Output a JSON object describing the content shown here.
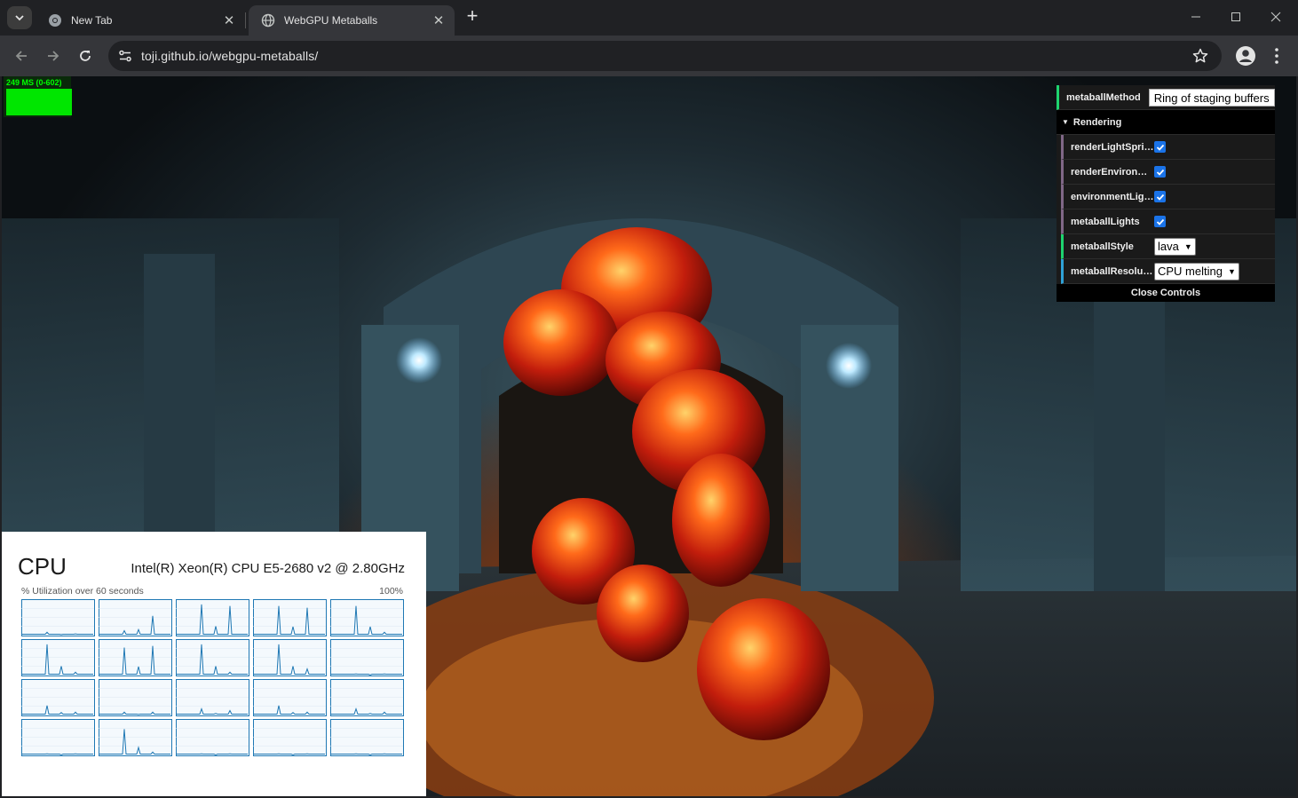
{
  "browser": {
    "tabs": [
      {
        "title": "New Tab",
        "active": false,
        "icon": "chrome-icon"
      },
      {
        "title": "WebGPU Metaballs",
        "active": true,
        "icon": "globe-icon"
      }
    ],
    "url": "toji.github.io/webgpu-metaballs/"
  },
  "stats": {
    "text": "249 MS (0-602)"
  },
  "gui": {
    "metaball_method": {
      "label": "metaballMethod",
      "value": "Ring of staging buffers"
    },
    "rendering_folder": "Rendering",
    "options": [
      {
        "label": "renderLightSprites",
        "checked": true
      },
      {
        "label": "renderEnvironm...",
        "checked": true
      },
      {
        "label": "environmentLights",
        "checked": true
      },
      {
        "label": "metaballLights",
        "checked": true
      }
    ],
    "metaball_style": {
      "label": "metaballStyle",
      "value": "lava"
    },
    "metaball_resolution": {
      "label": "metaballResolut...",
      "value": "CPU melting"
    },
    "close_label": "Close Controls"
  },
  "task_manager": {
    "title": "CPU",
    "processor": "Intel(R) Xeon(R) CPU E5-2680 v2 @ 2.80GHz",
    "subtitle": "% Utilization over 60 seconds",
    "max_label": "100%",
    "core_count": 20,
    "accent_color": "#1f78b4"
  },
  "colors": {
    "stats_green": "#00e600",
    "gui_green": "#1ed36f",
    "gui_purple": "#806787",
    "gui_blue": "#2fa1d6"
  }
}
